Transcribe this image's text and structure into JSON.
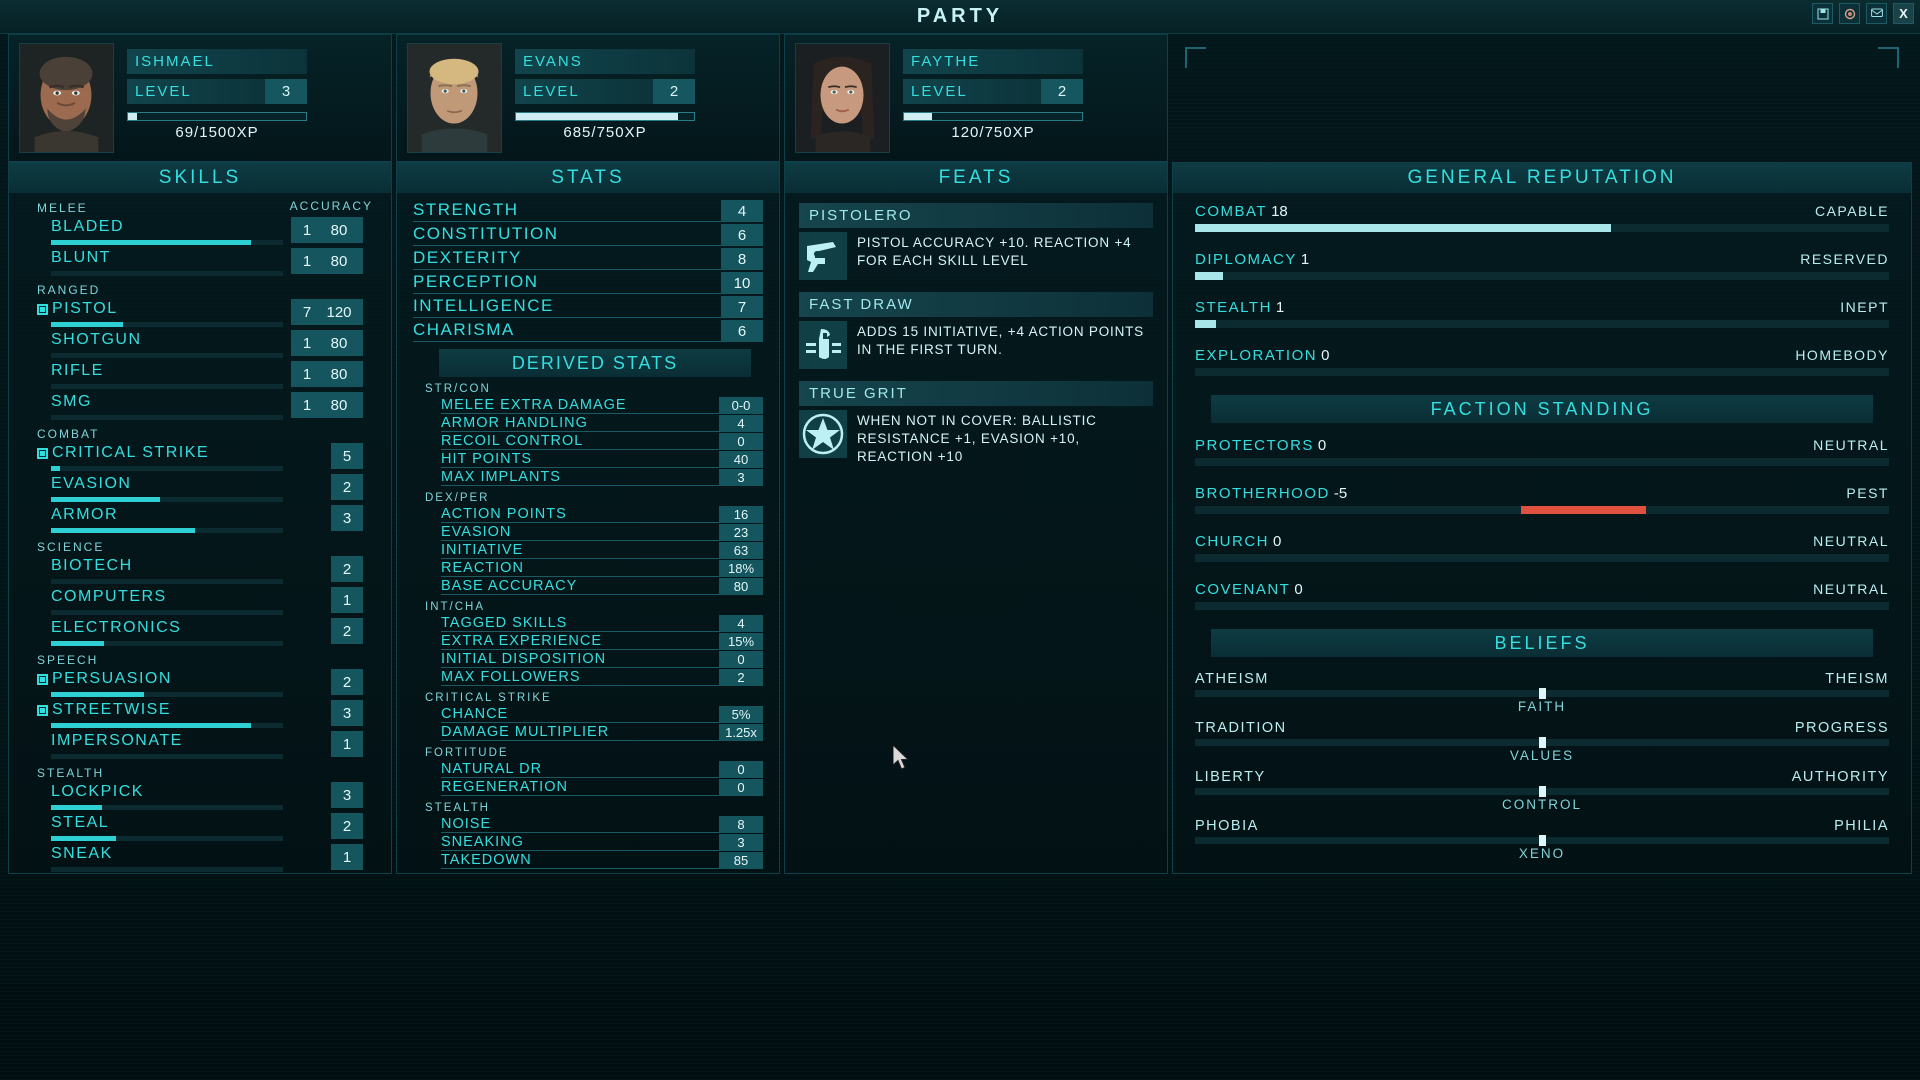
{
  "window": {
    "title": "PARTY",
    "buttons": [
      {
        "name": "save-icon",
        "glyph": "▣"
      },
      {
        "name": "help-icon",
        "glyph": "●"
      },
      {
        "name": "message-icon",
        "glyph": "✉"
      },
      {
        "name": "close-icon",
        "glyph": "X"
      }
    ]
  },
  "characters": [
    {
      "name": "ISHMAEL",
      "level_label": "LEVEL",
      "level": "3",
      "xp_text": "69/1500XP",
      "xp_percent": 5
    },
    {
      "name": "EVANS",
      "level_label": "LEVEL",
      "level": "2",
      "xp_text": "685/750XP",
      "xp_percent": 91
    },
    {
      "name": "FAYTHE",
      "level_label": "LEVEL",
      "level": "2",
      "xp_text": "120/750XP",
      "xp_percent": 16
    }
  ],
  "skills": {
    "title": "SKILLS",
    "accuracy_header": "ACCURACY",
    "groups": [
      {
        "label": "MELEE",
        "items": [
          {
            "name": "BLADED",
            "tagged": false,
            "level": "1",
            "accuracy": "80",
            "fill": 86
          },
          {
            "name": "BLUNT",
            "tagged": false,
            "level": "1",
            "accuracy": "80",
            "fill": 0
          }
        ]
      },
      {
        "label": "RANGED",
        "items": [
          {
            "name": "PISTOL",
            "tagged": true,
            "level": "7",
            "accuracy": "120",
            "fill": 31
          },
          {
            "name": "SHOTGUN",
            "tagged": false,
            "level": "1",
            "accuracy": "80",
            "fill": 0
          },
          {
            "name": "RIFLE",
            "tagged": false,
            "level": "1",
            "accuracy": "80",
            "fill": 0
          },
          {
            "name": "SMG",
            "tagged": false,
            "level": "1",
            "accuracy": "80",
            "fill": 0
          }
        ]
      },
      {
        "label": "COMBAT",
        "items": [
          {
            "name": "CRITICAL STRIKE",
            "tagged": true,
            "level": "5",
            "accuracy": "",
            "fill": 4
          },
          {
            "name": "EVASION",
            "tagged": false,
            "level": "2",
            "accuracy": "",
            "fill": 47
          },
          {
            "name": "ARMOR",
            "tagged": false,
            "level": "3",
            "accuracy": "",
            "fill": 62
          }
        ]
      },
      {
        "label": "SCIENCE",
        "items": [
          {
            "name": "BIOTECH",
            "tagged": false,
            "level": "2",
            "accuracy": "",
            "fill": 0
          },
          {
            "name": "COMPUTERS",
            "tagged": false,
            "level": "1",
            "accuracy": "",
            "fill": 0
          },
          {
            "name": "ELECTRONICS",
            "tagged": false,
            "level": "2",
            "accuracy": "",
            "fill": 23
          }
        ]
      },
      {
        "label": "SPEECH",
        "items": [
          {
            "name": "PERSUASION",
            "tagged": true,
            "level": "2",
            "accuracy": "",
            "fill": 40
          },
          {
            "name": "STREETWISE",
            "tagged": true,
            "level": "3",
            "accuracy": "",
            "fill": 86
          },
          {
            "name": "IMPERSONATE",
            "tagged": false,
            "level": "1",
            "accuracy": "",
            "fill": 0
          }
        ]
      },
      {
        "label": "STEALTH",
        "items": [
          {
            "name": "LOCKPICK",
            "tagged": false,
            "level": "3",
            "accuracy": "",
            "fill": 22
          },
          {
            "name": "STEAL",
            "tagged": false,
            "level": "2",
            "accuracy": "",
            "fill": 28
          },
          {
            "name": "SNEAK",
            "tagged": false,
            "level": "1",
            "accuracy": "",
            "fill": 0
          }
        ]
      }
    ]
  },
  "stats": {
    "title": "STATS",
    "primary": [
      {
        "name": "STRENGTH",
        "value": "4"
      },
      {
        "name": "CONSTITUTION",
        "value": "6"
      },
      {
        "name": "DEXTERITY",
        "value": "8"
      },
      {
        "name": "PERCEPTION",
        "value": "10"
      },
      {
        "name": "INTELLIGENCE",
        "value": "7"
      },
      {
        "name": "CHARISMA",
        "value": "6"
      }
    ],
    "derived_title": "DERIVED STATS",
    "derived_groups": [
      {
        "label": "STR/CON",
        "items": [
          {
            "name": "MELEE EXTRA DAMAGE",
            "value": "0-0"
          },
          {
            "name": "ARMOR HANDLING",
            "value": "4"
          },
          {
            "name": "RECOIL CONTROL",
            "value": "0"
          },
          {
            "name": "HIT POINTS",
            "value": "40"
          },
          {
            "name": "MAX IMPLANTS",
            "value": "3"
          }
        ]
      },
      {
        "label": "DEX/PER",
        "items": [
          {
            "name": "ACTION POINTS",
            "value": "16"
          },
          {
            "name": "EVASION",
            "value": "23"
          },
          {
            "name": "INITIATIVE",
            "value": "63"
          },
          {
            "name": "REACTION",
            "value": "18%"
          },
          {
            "name": "BASE ACCURACY",
            "value": "80"
          }
        ]
      },
      {
        "label": "INT/CHA",
        "items": [
          {
            "name": "TAGGED SKILLS",
            "value": "4"
          },
          {
            "name": "EXTRA EXPERIENCE",
            "value": "15%"
          },
          {
            "name": "INITIAL DISPOSITION",
            "value": "0"
          },
          {
            "name": "MAX FOLLOWERS",
            "value": "2"
          }
        ]
      },
      {
        "label": "CRITICAL STRIKE",
        "items": [
          {
            "name": "CHANCE",
            "value": "5%"
          },
          {
            "name": "DAMAGE MULTIPLIER",
            "value": "1.25x"
          }
        ]
      },
      {
        "label": "FORTITUDE",
        "items": [
          {
            "name": "NATURAL DR",
            "value": "0"
          },
          {
            "name": "REGENERATION",
            "value": "0"
          }
        ]
      },
      {
        "label": "STEALTH",
        "items": [
          {
            "name": "NOISE",
            "value": "8"
          },
          {
            "name": "SNEAKING",
            "value": "3"
          },
          {
            "name": "TAKEDOWN",
            "value": "85"
          }
        ]
      }
    ]
  },
  "feats": {
    "title": "FEATS",
    "items": [
      {
        "name": "PISTOLERO",
        "icon": "revolver-icon",
        "description": "PISTOL ACCURACY +10. REACTION +4 FOR EACH SKILL LEVEL"
      },
      {
        "name": "FAST DRAW",
        "icon": "holster-icon",
        "description": "ADDS 15 INITIATIVE, +4 ACTION POINTS IN THE FIRST TURN."
      },
      {
        "name": "TRUE GRIT",
        "icon": "star-icon",
        "description": "WHEN NOT IN COVER: BALLISTIC RESISTANCE +1, EVASION +10, REACTION +10"
      }
    ]
  },
  "reputation": {
    "title": "GENERAL REPUTATION",
    "items": [
      {
        "name": "COMBAT",
        "value": "18",
        "status": "CAPABLE",
        "fill": 60,
        "negative": false
      },
      {
        "name": "DIPLOMACY",
        "value": "1",
        "status": "RESERVED",
        "fill": 4,
        "negative": false
      },
      {
        "name": "STEALTH",
        "value": "1",
        "status": "INEPT",
        "fill": 3,
        "negative": false
      },
      {
        "name": "EXPLORATION",
        "value": "0",
        "status": "HOMEBODY",
        "fill": 0,
        "negative": false
      }
    ]
  },
  "faction": {
    "title": "FACTION STANDING",
    "items": [
      {
        "name": "PROTECTORS",
        "value": "0",
        "status": "NEUTRAL",
        "fill": 0,
        "negative": false
      },
      {
        "name": "BROTHERHOOD",
        "value": "-5",
        "status": "PEST",
        "fill": 18,
        "negative": true
      },
      {
        "name": "CHURCH",
        "value": "0",
        "status": "NEUTRAL",
        "fill": 0,
        "negative": false
      },
      {
        "name": "COVENANT",
        "value": "0",
        "status": "NEUTRAL",
        "fill": 0,
        "negative": false
      }
    ]
  },
  "beliefs": {
    "title": "BELIEFS",
    "items": [
      {
        "left": "ATHEISM",
        "right": "THEISM",
        "axis": "FAITH",
        "position": 50
      },
      {
        "left": "TRADITION",
        "right": "PROGRESS",
        "axis": "VALUES",
        "position": 50
      },
      {
        "left": "LIBERTY",
        "right": "AUTHORITY",
        "axis": "CONTROL",
        "position": 50
      },
      {
        "left": "PHOBIA",
        "right": "PHILIA",
        "axis": "XENO",
        "position": 50
      }
    ]
  }
}
